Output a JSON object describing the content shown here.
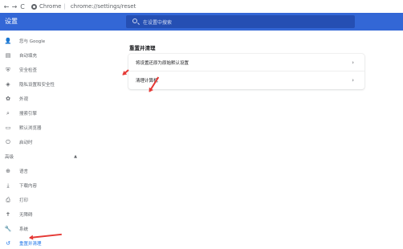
{
  "browser": {
    "back": "←",
    "forward": "→",
    "reload": "C",
    "host": "Chrome",
    "separator": "|",
    "path": "chrome://settings/reset"
  },
  "header": {
    "title": "设置",
    "search_placeholder": "在设置中搜索"
  },
  "sidebar": {
    "items": [
      {
        "label": "您与 Google",
        "icon": "person-icon",
        "glyph": "👤"
      },
      {
        "label": "自动填充",
        "icon": "clipboard-icon",
        "glyph": "▤"
      },
      {
        "label": "安全检查",
        "icon": "shield-icon",
        "glyph": "⛨"
      },
      {
        "label": "隐私设置和安全性",
        "icon": "shield-lock-icon",
        "glyph": "◈"
      },
      {
        "label": "外观",
        "icon": "palette-icon",
        "glyph": "✿"
      },
      {
        "label": "搜索引擎",
        "icon": "search-icon",
        "glyph": "⌕"
      },
      {
        "label": "默认浏览器",
        "icon": "browser-icon",
        "glyph": "▭"
      },
      {
        "label": "启动时",
        "icon": "power-icon",
        "glyph": "⏻"
      }
    ],
    "advanced": {
      "label": "高级",
      "caret": "▲"
    },
    "advanced_items": [
      {
        "label": "语言",
        "icon": "globe-icon",
        "glyph": "⊕"
      },
      {
        "label": "下载内容",
        "icon": "download-icon",
        "glyph": "⤓"
      },
      {
        "label": "打印",
        "icon": "printer-icon",
        "glyph": "⎙"
      },
      {
        "label": "无障碍",
        "icon": "accessibility-icon",
        "glyph": "✝"
      },
      {
        "label": "系统",
        "icon": "wrench-icon",
        "glyph": "🔧"
      },
      {
        "label": "重置并清理",
        "icon": "reset-icon",
        "glyph": "↺"
      }
    ]
  },
  "main": {
    "section_title": "重置并清理",
    "rows": [
      {
        "label": "将设置还原为原始默认设置",
        "chevron": "›"
      },
      {
        "label": "清理计算机",
        "chevron": "›"
      }
    ]
  },
  "colors": {
    "header_blue": "#3367d6",
    "active_blue": "#1a73e8",
    "annotation_red": "#e53935"
  }
}
